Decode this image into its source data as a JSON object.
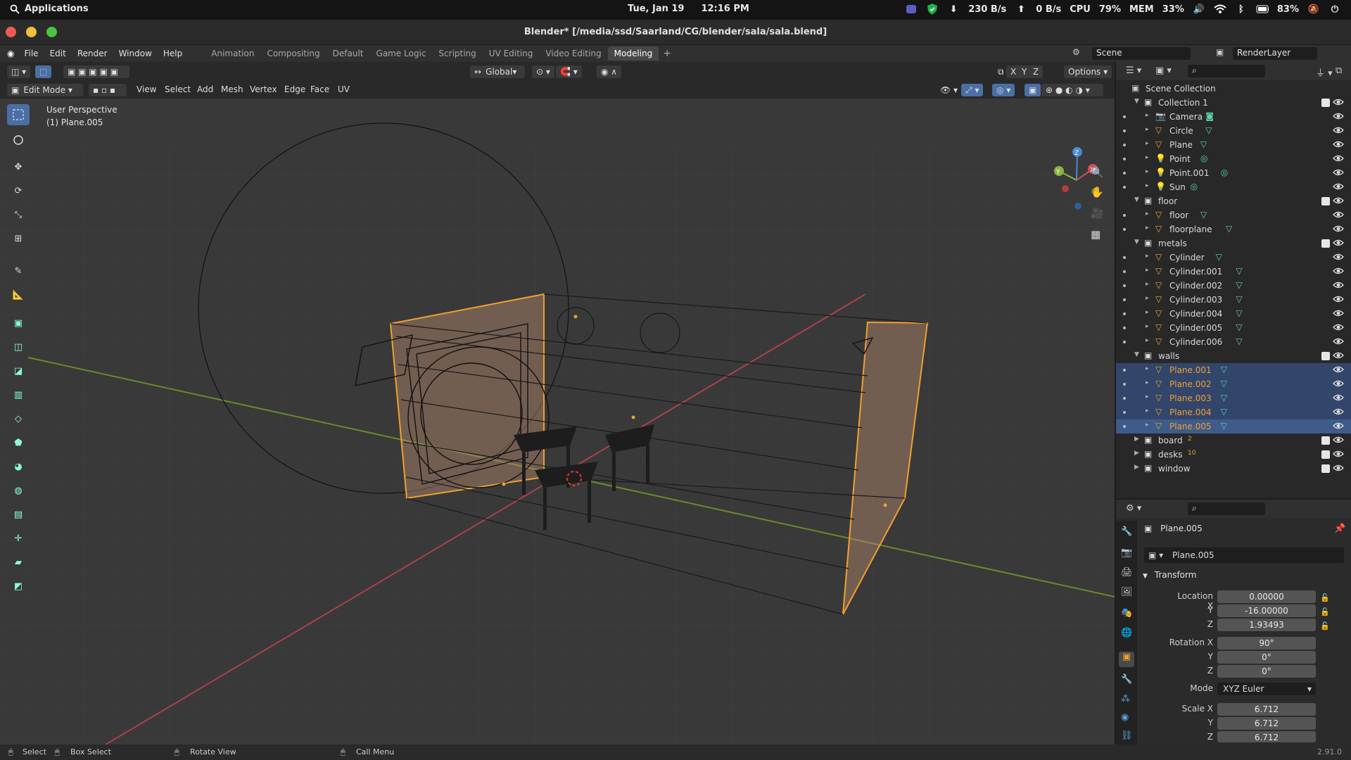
{
  "system": {
    "apps_label": "Applications",
    "date": "Tue, Jan 19",
    "time": "12:16 PM",
    "net_down": "230 B/s",
    "net_up": "0 B/s",
    "cpu_label": "CPU",
    "cpu_value": "79%",
    "mem_label": "MEM",
    "mem_value": "33%",
    "battery": "83%"
  },
  "window": {
    "title": "Blender* [/media/ssd/Saarland/CG/blender/sala/sala.blend]"
  },
  "menu": {
    "items": [
      "File",
      "Edit",
      "Render",
      "Window",
      "Help"
    ],
    "workspaces": [
      "Animation",
      "Compositing",
      "Default",
      "Game Logic",
      "Scripting",
      "UV Editing",
      "Video Editing",
      "Modeling"
    ],
    "active_workspace": "Modeling",
    "scene": "Scene",
    "render_layer": "RenderLayer"
  },
  "viewport_header": {
    "transform_orientation": "Global",
    "options": "Options",
    "axes": [
      "X",
      "Y",
      "Z"
    ],
    "mode": "Edit Mode",
    "menus": [
      "View",
      "Select",
      "Add",
      "Mesh",
      "Vertex",
      "Edge",
      "Face",
      "UV"
    ]
  },
  "viewport": {
    "perspective": "User Perspective",
    "object": "(1) Plane.005"
  },
  "outliner": {
    "root": "Scene Collection",
    "rows": [
      {
        "label": "Collection 1",
        "level": 1,
        "type": "collection",
        "expanded": true
      },
      {
        "label": "Camera",
        "level": 2,
        "type": "camera"
      },
      {
        "label": "Circle",
        "level": 2,
        "type": "mesh"
      },
      {
        "label": "Plane",
        "level": 2,
        "type": "mesh"
      },
      {
        "label": "Point",
        "level": 2,
        "type": "light"
      },
      {
        "label": "Point.001",
        "level": 2,
        "type": "light"
      },
      {
        "label": "Sun",
        "level": 2,
        "type": "light"
      },
      {
        "label": "floor",
        "level": 1,
        "type": "collection",
        "expanded": true
      },
      {
        "label": "floor",
        "level": 2,
        "type": "mesh"
      },
      {
        "label": "floorplane",
        "level": 2,
        "type": "mesh"
      },
      {
        "label": "metals",
        "level": 1,
        "type": "collection",
        "expanded": true
      },
      {
        "label": "Cylinder",
        "level": 2,
        "type": "mesh"
      },
      {
        "label": "Cylinder.001",
        "level": 2,
        "type": "mesh"
      },
      {
        "label": "Cylinder.002",
        "level": 2,
        "type": "mesh"
      },
      {
        "label": "Cylinder.003",
        "level": 2,
        "type": "mesh"
      },
      {
        "label": "Cylinder.004",
        "level": 2,
        "type": "mesh"
      },
      {
        "label": "Cylinder.005",
        "level": 2,
        "type": "mesh"
      },
      {
        "label": "Cylinder.006",
        "level": 2,
        "type": "mesh"
      },
      {
        "label": "walls",
        "level": 1,
        "type": "collection",
        "expanded": true
      },
      {
        "label": "Plane.001",
        "level": 2,
        "type": "mesh",
        "selected": true
      },
      {
        "label": "Plane.002",
        "level": 2,
        "type": "mesh",
        "selected": true
      },
      {
        "label": "Plane.003",
        "level": 2,
        "type": "mesh",
        "selected": true
      },
      {
        "label": "Plane.004",
        "level": 2,
        "type": "mesh",
        "selected": true
      },
      {
        "label": "Plane.005",
        "level": 2,
        "type": "mesh",
        "selected": true,
        "active": true
      },
      {
        "label": "board",
        "level": 1,
        "type": "collection",
        "expanded": false,
        "badge": "2"
      },
      {
        "label": "desks",
        "level": 1,
        "type": "collection",
        "expanded": false,
        "badge": "10"
      },
      {
        "label": "window",
        "level": 1,
        "type": "collection",
        "expanded": false
      }
    ]
  },
  "properties": {
    "object_name": "Plane.005",
    "data_name": "Plane.005",
    "section": "Transform",
    "location": {
      "label": "Location X",
      "x": "0.00000",
      "y": "-16.00000",
      "z": "1.93493"
    },
    "rotation": {
      "label": "Rotation X",
      "x": "90°",
      "y": "0°",
      "z": "0°"
    },
    "mode_label": "Mode",
    "mode_value": "XYZ Euler",
    "scale": {
      "label": "Scale X",
      "x": "6.712",
      "y": "6.712",
      "z": "6.712"
    },
    "y_label": "Y",
    "z_label": "Z"
  },
  "status": {
    "select": "Select",
    "box_select": "Box Select",
    "rotate_view": "Rotate View",
    "call_menu": "Call Menu",
    "version": "2.91.0"
  },
  "colors": {
    "accent_selection": "#4a6fa5",
    "highlight_orange": "#f0a030"
  }
}
